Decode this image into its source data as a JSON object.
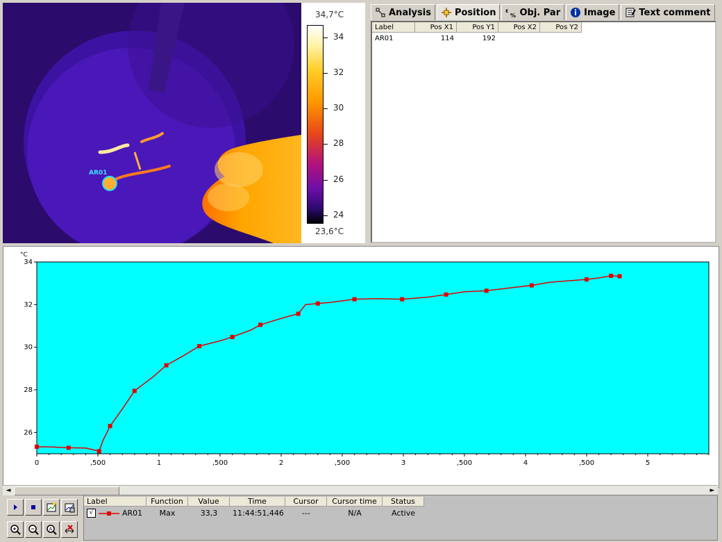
{
  "colorbar": {
    "max_label": "34,7°C",
    "min_label": "23,6°C",
    "ticks": [
      "34",
      "32",
      "30",
      "28",
      "26",
      "24"
    ]
  },
  "thermal": {
    "roi_label": "AR01"
  },
  "tabs": [
    {
      "label": "Analysis",
      "icon": "analysis-icon"
    },
    {
      "label": "Position",
      "icon": "position-icon"
    },
    {
      "label": "Obj. Par",
      "icon": "object-parameters-icon"
    },
    {
      "label": "Image",
      "icon": "info-icon"
    },
    {
      "label": "Text comment",
      "icon": "text-comment-icon"
    }
  ],
  "position_table": {
    "columns": [
      "Label",
      "Pos X1",
      "Pos Y1",
      "Pos X2",
      "Pos Y2"
    ],
    "rows": [
      {
        "label": "AR01",
        "x1": "114",
        "y1": "192",
        "x2": "",
        "y2": ""
      }
    ]
  },
  "chart_data": {
    "type": "line",
    "ylabel": "°C",
    "ylim": [
      25,
      34
    ],
    "xlim": [
      0,
      5.5
    ],
    "yticks": [
      "34",
      "32",
      "30",
      "28",
      "26"
    ],
    "xticks": [
      "0",
      ",500",
      "1",
      ",500",
      "2",
      ",500",
      "3",
      ",500",
      "4",
      ",500",
      "5"
    ],
    "background": "#00ffff",
    "series": [
      {
        "name": "AR01",
        "color": "#e00000",
        "x": [
          0,
          0.1,
          0.26,
          0.4,
          0.51,
          0.54,
          0.6,
          0.7,
          0.8,
          0.95,
          1.06,
          1.2,
          1.33,
          1.5,
          1.6,
          1.75,
          1.83,
          2.0,
          2.14,
          2.2,
          2.3,
          2.4,
          2.6,
          2.8,
          2.99,
          3.2,
          3.35,
          3.5,
          3.68,
          3.9,
          4.05,
          4.2,
          4.5,
          4.6,
          4.7,
          4.77
        ],
        "y": [
          25.33,
          25.32,
          25.28,
          25.27,
          25.12,
          25.6,
          26.3,
          27.1,
          27.95,
          28.6,
          29.15,
          29.6,
          30.05,
          30.3,
          30.48,
          30.8,
          31.05,
          31.35,
          31.57,
          32.0,
          32.05,
          32.1,
          32.25,
          32.28,
          32.25,
          32.35,
          32.47,
          32.6,
          32.65,
          32.8,
          32.9,
          33.05,
          33.18,
          33.25,
          33.35,
          33.33
        ]
      }
    ]
  },
  "legend_table": {
    "columns": [
      "Label",
      "Function",
      "Value",
      "Time",
      "Cursor",
      "Cursor time",
      "Status"
    ],
    "rows": [
      {
        "label": "AR01",
        "function": "Max",
        "value": "33,3",
        "time": "11:44:51,446",
        "cursor": "---",
        "cursor_time": "N/A",
        "status": "Active",
        "checked": "√"
      }
    ]
  }
}
